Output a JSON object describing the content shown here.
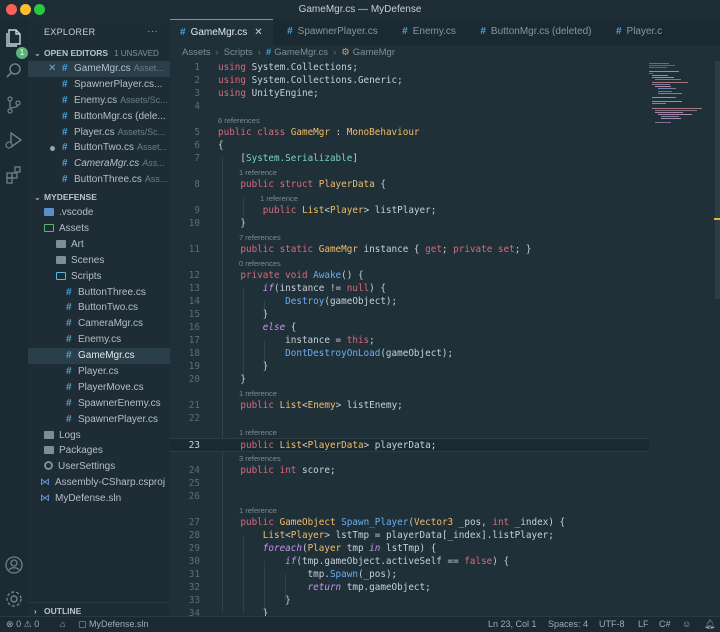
{
  "window": {
    "title": "GameMgr.cs — MyDefense"
  },
  "activity": {
    "explorer_badge": "1"
  },
  "sidebar": {
    "header": "EXPLORER",
    "more": "···",
    "open_editors": {
      "title": "OPEN EDITORS",
      "badge": "1 UNSAVED",
      "items": [
        {
          "name": "GameMgr.cs",
          "path": "Asset..."
        },
        {
          "name": "SpawnerPlayer.cs...",
          "path": ""
        },
        {
          "name": "Enemy.cs",
          "path": "Assets/Sc..."
        },
        {
          "name": "ButtonMgr.cs (dele...",
          "path": ""
        },
        {
          "name": "Player.cs",
          "path": "Assets/Sc..."
        },
        {
          "name": "ButtonTwo.cs",
          "path": "Asset..."
        },
        {
          "name": "CameraMgr.cs",
          "path": "Ass..."
        },
        {
          "name": "ButtonThree.cs",
          "path": "Ass..."
        }
      ]
    },
    "project": {
      "title": "MYDEFENSE",
      "items": [
        {
          "label": ".vscode"
        },
        {
          "label": "Assets"
        },
        {
          "label": "Art"
        },
        {
          "label": "Scenes"
        },
        {
          "label": "Scripts"
        },
        {
          "label": "ButtonThree.cs"
        },
        {
          "label": "ButtonTwo.cs"
        },
        {
          "label": "CameraMgr.cs"
        },
        {
          "label": "Enemy.cs"
        },
        {
          "label": "GameMgr.cs"
        },
        {
          "label": "Player.cs"
        },
        {
          "label": "PlayerMove.cs"
        },
        {
          "label": "SpawnerEnemy.cs"
        },
        {
          "label": "SpawnerPlayer.cs"
        },
        {
          "label": "Logs"
        },
        {
          "label": "Packages"
        },
        {
          "label": "UserSettings"
        },
        {
          "label": "Assembly-CSharp.csproj"
        },
        {
          "label": "MyDefense.sln"
        }
      ]
    },
    "outline": "OUTLINE"
  },
  "tabs": [
    {
      "label": "GameMgr.cs",
      "active": true
    },
    {
      "label": "SpawnerPlayer.cs"
    },
    {
      "label": "Enemy.cs"
    },
    {
      "label": "ButtonMgr.cs (deleted)"
    },
    {
      "label": "Player.c"
    }
  ],
  "breadcrumb": [
    "Assets",
    "Scripts",
    "GameMgr.cs",
    "GameMgr"
  ],
  "editor": {
    "current_line": 23,
    "lenses": {
      "r5": "6 references",
      "r8": "1 reference",
      "r9": "1 reference",
      "r11": "7 references",
      "r12": "0 references",
      "r21": "1 reference",
      "r23": "1 reference",
      "r24": "3 references",
      "r27": "1 reference"
    },
    "lines": {
      "l1": "1",
      "l2": "2",
      "l3": "3",
      "l4": "4",
      "l5": "5",
      "l6": "6",
      "l7": "7",
      "l8": "8",
      "l9": "9",
      "l10": "10",
      "l11": "11",
      "l12": "12",
      "l13": "13",
      "l14": "14",
      "l15": "15",
      "l16": "16",
      "l17": "17",
      "l18": "18",
      "l19": "19",
      "l20": "20",
      "l21": "21",
      "l22": "22",
      "l23": "23",
      "l24": "24",
      "l25": "25",
      "l26": "26",
      "l27": "27",
      "l28": "28",
      "l29": "29",
      "l30": "30",
      "l31": "31",
      "l32": "32",
      "l33": "33",
      "l34": "34"
    }
  },
  "statusbar": {
    "errors": "0",
    "warnings": "0",
    "solution": "MyDefense.sln",
    "position": "Ln 23, Col 1",
    "spaces": "Spaces: 4",
    "encoding": "UTF-8",
    "eol": "LF",
    "language": "C#"
  },
  "colors": {
    "background": "#1f3039",
    "sidebar": "#1e2d35",
    "keyword": "#d8697a",
    "type": "#f3bd68",
    "function": "#6aaef0",
    "control": "#c594e8",
    "attribute": "#7ad1cb",
    "modified_marker": "#e3b33b"
  }
}
